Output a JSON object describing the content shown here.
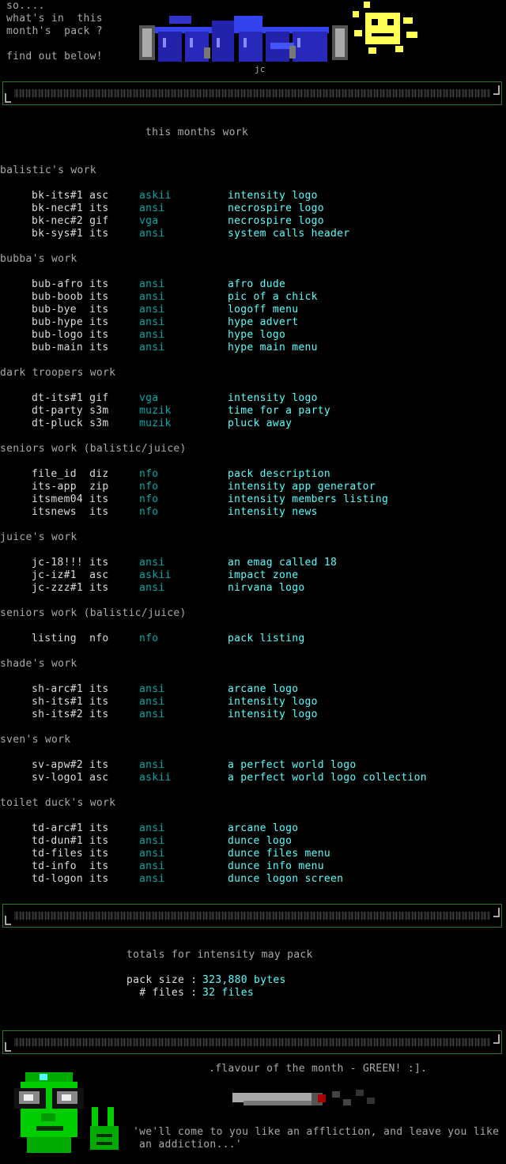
{
  "intro": {
    "line1": "so....",
    "line2": "what's in  this",
    "line3": "month's  pack ?",
    "line4": "find out below!",
    "logo_tag": "jc"
  },
  "section_title": "this months work",
  "groups": [
    {
      "title": "balistic's work",
      "rows": [
        {
          "file": "bk-its#1 asc",
          "type": "askii",
          "desc": "intensity logo"
        },
        {
          "file": "bk-nec#1 its",
          "type": "ansi",
          "desc": "necrospire logo"
        },
        {
          "file": "bk-nec#2 gif",
          "type": "vga",
          "desc": "necrospire logo"
        },
        {
          "file": "bk-sys#1 its",
          "type": "ansi",
          "desc": "system calls header"
        }
      ]
    },
    {
      "title": "bubba's work",
      "rows": [
        {
          "file": "bub-afro its",
          "type": "ansi",
          "desc": "afro dude"
        },
        {
          "file": "bub-boob its",
          "type": "ansi",
          "desc": "pic of a chick"
        },
        {
          "file": "bub-bye  its",
          "type": "ansi",
          "desc": "logoff menu"
        },
        {
          "file": "bub-hype its",
          "type": "ansi",
          "desc": "hype advert"
        },
        {
          "file": "bub-logo its",
          "type": "ansi",
          "desc": "hype logo"
        },
        {
          "file": "bub-main its",
          "type": "ansi",
          "desc": "hype main menu"
        }
      ]
    },
    {
      "title": "dark troopers work",
      "rows": [
        {
          "file": "dt-its#1 gif",
          "type": "vga",
          "desc": "intensity logo"
        },
        {
          "file": "dt-party s3m",
          "type": "muzik",
          "desc": "time for a party"
        },
        {
          "file": "dt-pluck s3m",
          "type": "muzik",
          "desc": "pluck away"
        }
      ]
    },
    {
      "title": "seniors work (balistic/juice)",
      "rows": [
        {
          "file": "file_id  diz",
          "type": "nfo",
          "desc": "pack description"
        },
        {
          "file": "its-app  zip",
          "type": "nfo",
          "desc": "intensity app generator"
        },
        {
          "file": "itsmem04 its",
          "type": "nfo",
          "desc": "intensity members listing"
        },
        {
          "file": "itsnews  its",
          "type": "nfo",
          "desc": "intensity news"
        }
      ]
    },
    {
      "title": "juice's work",
      "rows": [
        {
          "file": "jc-18!!! its",
          "type": "ansi",
          "desc": "an emag called 18"
        },
        {
          "file": "jc-iz#1  asc",
          "type": "askii",
          "desc": "impact zone"
        },
        {
          "file": "jc-zzz#1 its",
          "type": "ansi",
          "desc": "nirvana logo"
        }
      ]
    },
    {
      "title": "seniors work (balistic/juice)",
      "rows": [
        {
          "file": "listing  nfo",
          "type": "nfo",
          "desc": "pack listing"
        }
      ]
    },
    {
      "title": "shade's work",
      "rows": [
        {
          "file": "sh-arc#1 its",
          "type": "ansi",
          "desc": "arcane logo"
        },
        {
          "file": "sh-its#1 its",
          "type": "ansi",
          "desc": "intensity logo"
        },
        {
          "file": "sh-its#2 its",
          "type": "ansi",
          "desc": "intensity logo"
        }
      ]
    },
    {
      "title": "sven's work",
      "rows": [
        {
          "file": "sv-apw#2 its",
          "type": "ansi",
          "desc": "a perfect world logo"
        },
        {
          "file": "sv-logo1 asc",
          "type": "askii",
          "desc": "a perfect world logo collection"
        }
      ]
    },
    {
      "title": "toilet duck's work",
      "rows": [
        {
          "file": "td-arc#1 its",
          "type": "ansi",
          "desc": "arcane logo"
        },
        {
          "file": "td-dun#1 its",
          "type": "ansi",
          "desc": "dunce logo"
        },
        {
          "file": "td-files its",
          "type": "ansi",
          "desc": "dunce files menu"
        },
        {
          "file": "td-info  its",
          "type": "ansi",
          "desc": "dunce info menu"
        },
        {
          "file": "td-logon its",
          "type": "ansi",
          "desc": "dunce logon screen"
        }
      ]
    }
  ],
  "totals": {
    "title": "totals for intensity may pack",
    "size_label": "pack size :",
    "size_value": "323,880 bytes",
    "files_label": "  # files :",
    "files_value": "32 files"
  },
  "footer": {
    "flavour": ".flavour of the month - GREEN! :].",
    "quote1": "'we'll come to you like an affliction, and leave you like",
    "quote2": "an addiction...'"
  },
  "colors": {
    "background": "#000000",
    "text": "#aaaaaa",
    "highlight": "#55ffff",
    "type": "#00aaaa",
    "accent": "#2a7a2a"
  }
}
